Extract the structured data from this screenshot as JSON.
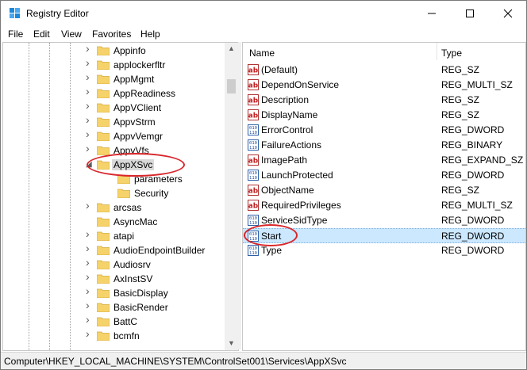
{
  "window": {
    "title": "Registry Editor"
  },
  "menu": [
    "File",
    "Edit",
    "View",
    "Favorites",
    "Help"
  ],
  "tree": {
    "items": [
      {
        "label": "Appinfo",
        "level": 1,
        "expander": "collapsed"
      },
      {
        "label": "applockerfltr",
        "level": 1,
        "expander": "collapsed"
      },
      {
        "label": "AppMgmt",
        "level": 1,
        "expander": "collapsed"
      },
      {
        "label": "AppReadiness",
        "level": 1,
        "expander": "collapsed"
      },
      {
        "label": "AppVClient",
        "level": 1,
        "expander": "collapsed"
      },
      {
        "label": "AppvStrm",
        "level": 1,
        "expander": "collapsed"
      },
      {
        "label": "AppvVemgr",
        "level": 1,
        "expander": "collapsed"
      },
      {
        "label": "AppvVfs",
        "level": 1,
        "expander": "collapsed"
      },
      {
        "label": "AppXSvc",
        "level": 1,
        "expander": "expanded",
        "selected": true
      },
      {
        "label": "parameters",
        "level": 2,
        "expander": "none"
      },
      {
        "label": "Security",
        "level": 2,
        "expander": "none"
      },
      {
        "label": "arcsas",
        "level": 1,
        "expander": "collapsed"
      },
      {
        "label": "AsyncMac",
        "level": 1,
        "expander": "none"
      },
      {
        "label": "atapi",
        "level": 1,
        "expander": "collapsed"
      },
      {
        "label": "AudioEndpointBuilder",
        "level": 1,
        "expander": "collapsed"
      },
      {
        "label": "Audiosrv",
        "level": 1,
        "expander": "collapsed"
      },
      {
        "label": "AxInstSV",
        "level": 1,
        "expander": "collapsed"
      },
      {
        "label": "BasicDisplay",
        "level": 1,
        "expander": "collapsed"
      },
      {
        "label": "BasicRender",
        "level": 1,
        "expander": "collapsed"
      },
      {
        "label": "BattC",
        "level": 1,
        "expander": "collapsed"
      },
      {
        "label": "bcmfn",
        "level": 1,
        "expander": "collapsed"
      }
    ]
  },
  "values": {
    "columns": {
      "name": "Name",
      "type": "Type"
    },
    "rows": [
      {
        "name": "(Default)",
        "type": "REG_SZ",
        "icon": "string-value-icon"
      },
      {
        "name": "DependOnService",
        "type": "REG_MULTI_SZ",
        "icon": "string-value-icon"
      },
      {
        "name": "Description",
        "type": "REG_SZ",
        "icon": "string-value-icon"
      },
      {
        "name": "DisplayName",
        "type": "REG_SZ",
        "icon": "string-value-icon"
      },
      {
        "name": "ErrorControl",
        "type": "REG_DWORD",
        "icon": "binary-value-icon"
      },
      {
        "name": "FailureActions",
        "type": "REG_BINARY",
        "icon": "binary-value-icon"
      },
      {
        "name": "ImagePath",
        "type": "REG_EXPAND_SZ",
        "icon": "string-value-icon"
      },
      {
        "name": "LaunchProtected",
        "type": "REG_DWORD",
        "icon": "binary-value-icon"
      },
      {
        "name": "ObjectName",
        "type": "REG_SZ",
        "icon": "string-value-icon"
      },
      {
        "name": "RequiredPrivileges",
        "type": "REG_MULTI_SZ",
        "icon": "string-value-icon"
      },
      {
        "name": "ServiceSidType",
        "type": "REG_DWORD",
        "icon": "binary-value-icon"
      },
      {
        "name": "Start",
        "type": "REG_DWORD",
        "icon": "binary-value-icon",
        "selected": true
      },
      {
        "name": "Type",
        "type": "REG_DWORD",
        "icon": "binary-value-icon"
      }
    ]
  },
  "status": {
    "path": "Computer\\HKEY_LOCAL_MACHINE\\SYSTEM\\ControlSet001\\Services\\AppXSvc"
  },
  "colors": {
    "selection": "#cce8ff",
    "annotation": "#d9262b",
    "folder": "#f6d36a"
  }
}
